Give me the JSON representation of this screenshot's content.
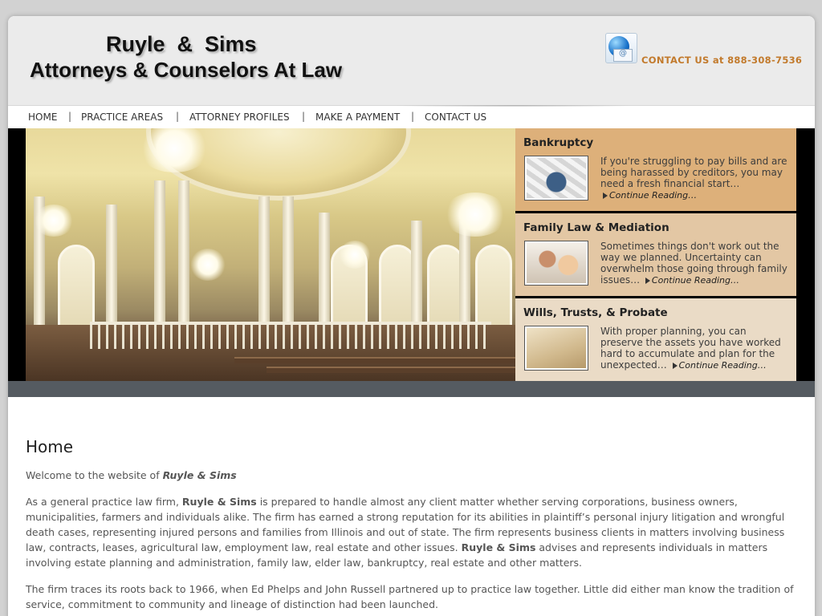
{
  "header": {
    "logo_line1": "Ruyle  &  Sims",
    "logo_line2": "Attorneys & Counselors At Law",
    "contact_icon": "globe-email-icon",
    "contact_text": "CONTACT US at 888-308-7536"
  },
  "nav": {
    "items": [
      "HOME",
      "PRACTICE AREAS",
      "ATTORNEY PROFILES",
      "MAKE A PAYMENT",
      "CONTACT US"
    ],
    "separator": "|"
  },
  "panels": [
    {
      "title": "Bankruptcy",
      "text": "If you're struggling to pay bills and are being harassed by creditors, you may need a fresh financial start…",
      "more": "Continue Reading…",
      "thumb_icon": "bankruptcy-photo",
      "bg": "#ddb07a"
    },
    {
      "title": "Family Law & Mediation",
      "text": "Sometimes things don't work out the way we planned. Uncertainty can overwhelm those going through family issues…",
      "more": "Continue Reading…",
      "thumb_icon": "family-photo",
      "bg": "#e3c7a4"
    },
    {
      "title": "Wills, Trusts, & Probate",
      "text": "With proper planning, you can preserve the assets you have worked hard to accumulate and plan for the unexpected…",
      "more": "Continue Reading…",
      "thumb_icon": "last-will-testament-photo",
      "bg": "#eadbc6"
    }
  ],
  "content": {
    "heading": "Home",
    "welcome_prefix": "Welcome to the website of ",
    "firm_name": "Ruyle & Sims",
    "p1_a": "As a general practice law firm, ",
    "p1_b": " is prepared to handle almost any client matter whether serving corporations, business owners, municipalities, farmers and individuals alike. The firm has earned a strong reputation for its abilities in plaintiff’s personal injury litigation and wrongful death cases, representing injured persons and families from Illinois and out of state. The firm represents business clients in matters involving business law, contracts, leases, agricultural law, employment law, real estate and other issues. ",
    "p1_c": " advises and represents individuals in matters involving estate planning and administration, family law, elder law, bankruptcy, real estate and other matters.",
    "p2": "The firm traces its roots back to 1966, when Ed Phelps and John Russell partnered up to practice law together. Little did either man know the tradition of service, commitment to community and lineage of distinction had been launched."
  },
  "colors": {
    "accent": "#c27a2c",
    "header_bg": "#ebebeb",
    "status_bar": "#555b61"
  }
}
